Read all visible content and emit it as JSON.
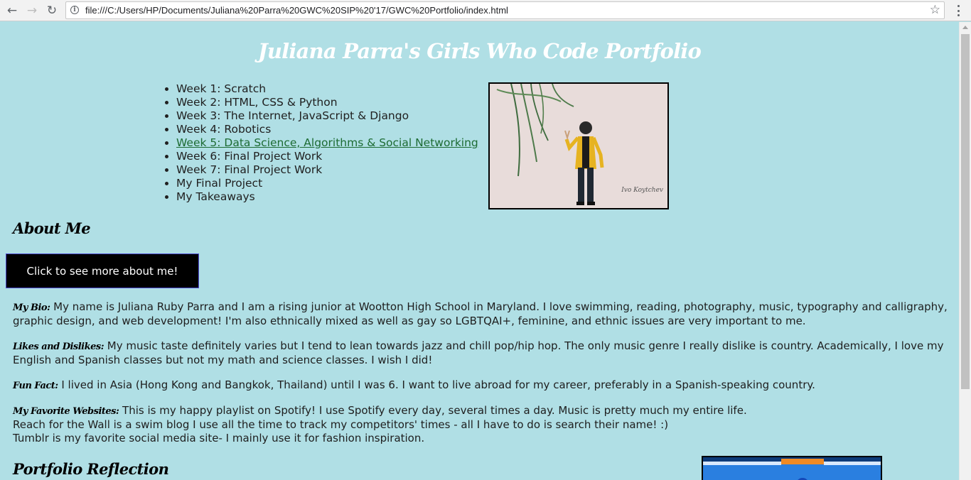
{
  "browser": {
    "url": "file:///C:/Users/HP/Documents/Juliana%20Parra%20GWC%20SIP%20'17/GWC%20Portfolio/index.html"
  },
  "page": {
    "title": "Juliana Parra's Girls Who Code Portfolio",
    "weeks": [
      {
        "label": "Week 1: Scratch"
      },
      {
        "label": "Week 2: HTML, CSS & Python"
      },
      {
        "label": "Week 3: The Internet, JavaScript & Django"
      },
      {
        "label": "Week 4: Robotics"
      },
      {
        "label": "Week 5: Data Science, Algorithms & Social Networking",
        "hovered": true
      },
      {
        "label": "Week 6: Final Project Work"
      },
      {
        "label": "Week 7: Final Project Work"
      },
      {
        "label": "My Final Project"
      },
      {
        "label": "My Takeaways"
      }
    ],
    "photo_credit": "Ivo Koytchev",
    "about_heading": "About Me",
    "about_button": "Click to see more about me!",
    "bio": {
      "label": "My Bio:",
      "text": " My name is Juliana Ruby Parra and I am a rising junior at Wootton High School in Maryland. I love swimming, reading, photography, music, typography and calligraphy, graphic design, and web development! I'm also ethnically mixed as well as gay so LGBTQAI+, feminine, and ethnic issues are very important to me."
    },
    "likes": {
      "label": "Likes and Dislikes:",
      "text": " My music taste definitely varies but I tend to lean towards jazz and chill pop/hip hop. The only music genre I really dislike is country. Academically, I love my English and Spanish classes but not my math and science classes. I wish I did!"
    },
    "fun_fact": {
      "label": "Fun Fact:",
      "text": " I lived in Asia (Hong Kong and Bangkok, Thailand) until I was 6. I want to live abroad for my career, preferably in a Spanish-speaking country."
    },
    "websites": {
      "label": "My Favorite Websites:",
      "line1": " This is my happy playlist on Spotify! I use Spotify every day, several times a day. Music is pretty much my entire life.",
      "line2": "Reach for the Wall is a swim blog I use all the time to track my competitors' times - all I have to do is search their name! :)",
      "line3": "Tumblr is my favorite social media site- I mainly use it for fashion inspiration."
    },
    "reflection_heading": "Portfolio Reflection"
  },
  "colors": {
    "page_background": "#b0dfe5",
    "title": "#ffffff",
    "link_hover": "#1d6b33",
    "button_background": "#000000"
  }
}
